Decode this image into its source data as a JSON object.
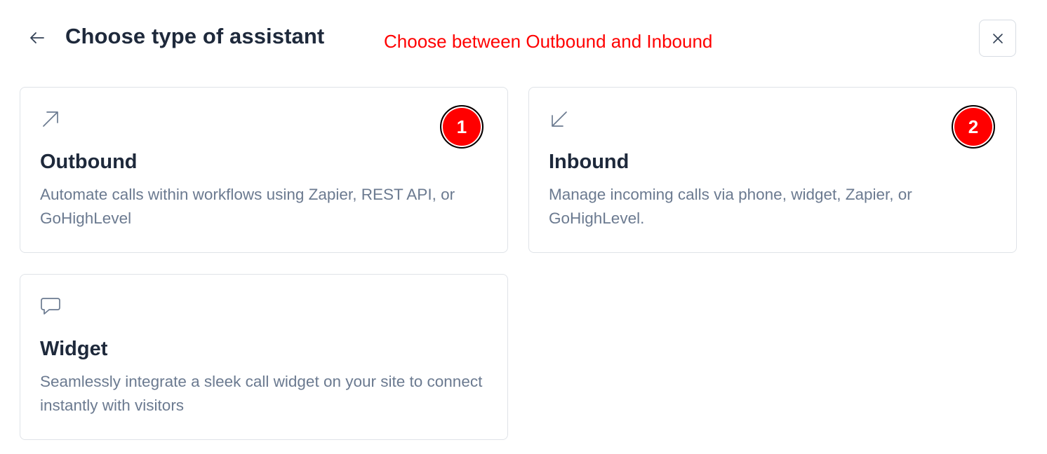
{
  "header": {
    "back_icon": "arrow-left-icon",
    "title": "Choose type of assistant",
    "annotation": "Choose between Outbound and Inbound",
    "close_icon": "close-icon"
  },
  "cards": [
    {
      "id": "outbound",
      "icon": "arrow-up-right-icon",
      "title": "Outbound",
      "description": "Automate calls within workflows using Zapier, REST API, or GoHighLevel",
      "badge": "1"
    },
    {
      "id": "inbound",
      "icon": "arrow-down-left-icon",
      "title": "Inbound",
      "description": "Manage incoming calls via phone, widget, Zapier, or GoHighLevel.",
      "badge": "2"
    },
    {
      "id": "widget",
      "icon": "message-bubble-icon",
      "title": "Widget",
      "description": "Seamlessly integrate a sleek call widget on your site to connect instantly with visitors"
    }
  ],
  "colors": {
    "annotation": "#ff0000",
    "badge": "#ff0000",
    "title": "#1e293b",
    "description": "#6b7a90",
    "border": "#dfe3e8"
  }
}
